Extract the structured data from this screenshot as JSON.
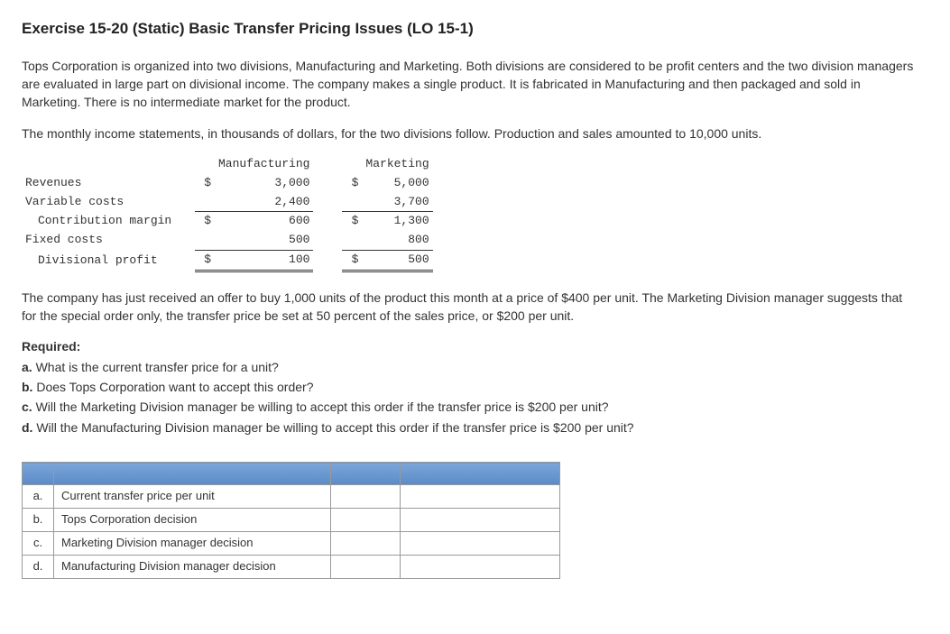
{
  "title": "Exercise 15-20 (Static) Basic Transfer Pricing Issues (LO 15-1)",
  "para1": "Tops Corporation is organized into two divisions, Manufacturing and Marketing. Both divisions are considered to be profit centers and the two division managers are evaluated in large part on divisional income. The company makes a single product. It is fabricated in Manufacturing and then packaged and sold in Marketing. There is no intermediate market for the product.",
  "para2": "The monthly income statements, in thousands of dollars, for the two divisions follow. Production and sales amounted to 10,000 units.",
  "income": {
    "head1": "Manufacturing",
    "head2": "Marketing",
    "rows": {
      "rev": {
        "label": "Revenues",
        "m_sym": "$",
        "m_val": "3,000",
        "k_sym": "$",
        "k_val": "5,000"
      },
      "var": {
        "label": "Variable costs",
        "m_sym": "",
        "m_val": "2,400",
        "k_sym": "",
        "k_val": "3,700"
      },
      "cm": {
        "label": "Contribution margin",
        "m_sym": "$",
        "m_val": "600",
        "k_sym": "$",
        "k_val": "1,300"
      },
      "fix": {
        "label": "Fixed costs",
        "m_sym": "",
        "m_val": "500",
        "k_sym": "",
        "k_val": "800"
      },
      "prof": {
        "label": "Divisional profit",
        "m_sym": "$",
        "m_val": "100",
        "k_sym": "$",
        "k_val": "500"
      }
    }
  },
  "para3": "The company has just received an offer to buy 1,000 units of the product this month at a price of $400 per unit. The Marketing Division manager suggests that for the special order only, the transfer price be set at 50 percent of the sales price, or $200 per unit.",
  "required_label": "Required:",
  "req_a": "a. ",
  "req_a_text": "What is the current transfer price for a unit?",
  "req_b": "b. ",
  "req_b_text": "Does Tops Corporation want to accept this order?",
  "req_c": "c. ",
  "req_c_text": "Will the Marketing Division manager be willing to accept this order if the transfer price is $200 per unit?",
  "req_d": "d. ",
  "req_d_text": "Will the Manufacturing Division manager be willing to accept this order if the transfer price is $200 per unit?",
  "answers": {
    "a": {
      "key": "a.",
      "desc": "Current transfer price per unit"
    },
    "b": {
      "key": "b.",
      "desc": "Tops Corporation decision"
    },
    "c": {
      "key": "c.",
      "desc": "Marketing Division manager decision"
    },
    "d": {
      "key": "d.",
      "desc": "Manufacturing Division manager decision"
    }
  }
}
